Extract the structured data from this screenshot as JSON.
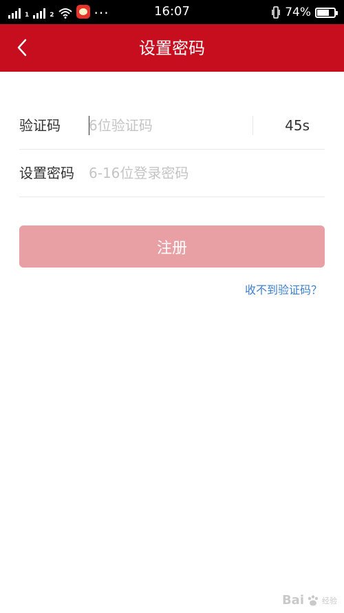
{
  "status_bar": {
    "time": "16:07",
    "battery_percent": "74%",
    "battery_level": 0.74,
    "sim_tags": [
      "1",
      "2"
    ],
    "more": "···"
  },
  "header": {
    "title": "设置密码",
    "back_icon": "chevron-left-icon",
    "color": "#c70e1f"
  },
  "form": {
    "code_label": "验证码",
    "code_placeholder": "6位验证码",
    "code_value": "",
    "countdown": "45s",
    "password_label": "设置密码",
    "password_placeholder": "6-16位登录密码",
    "password_value": ""
  },
  "register_button": {
    "label": "注册",
    "color": "#e9a0a4"
  },
  "help_link": "收不到验证码？",
  "watermark": {
    "brand": "Bai",
    "suffix": "经验"
  }
}
